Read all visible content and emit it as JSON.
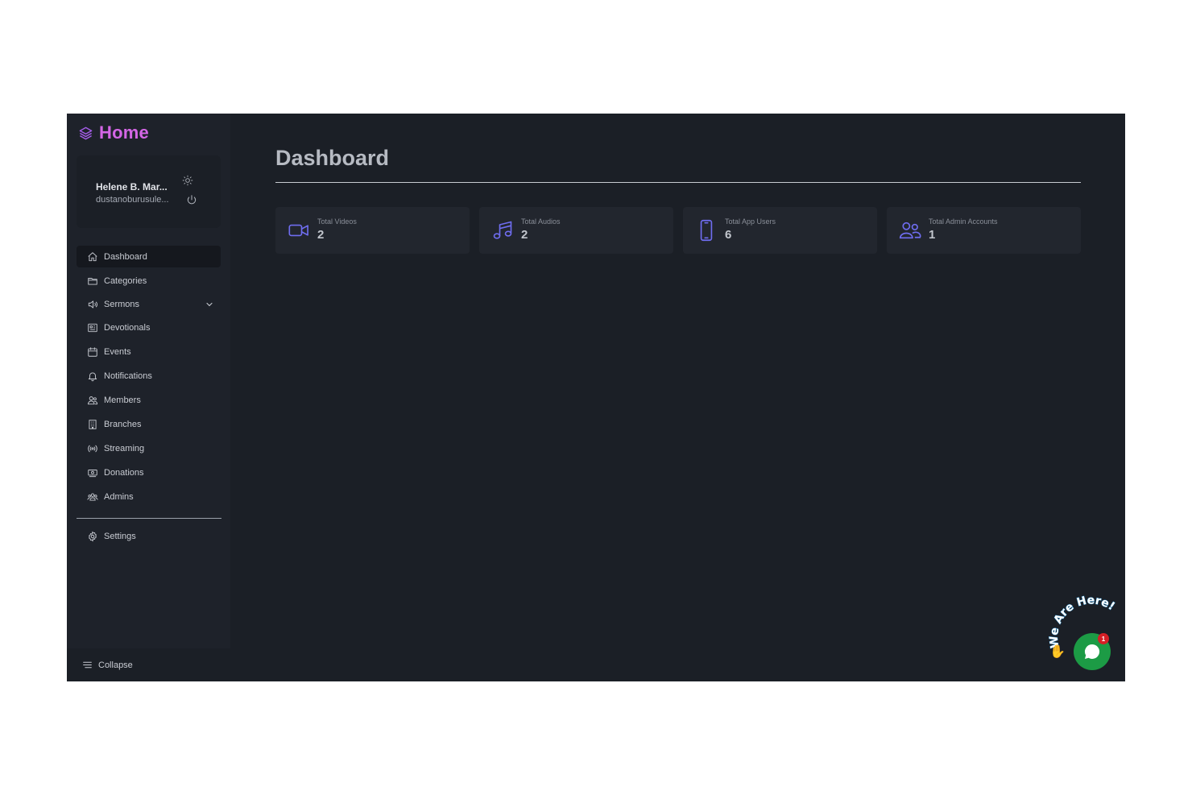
{
  "brand": {
    "title": "Home",
    "icon": "layers-icon",
    "color": "#d466e6"
  },
  "user": {
    "name": "Helene B. Mar...",
    "email": "dustanoburusule..."
  },
  "sidebar": {
    "items": [
      {
        "label": "Dashboard",
        "icon": "home-icon",
        "active": true
      },
      {
        "label": "Categories",
        "icon": "folder-icon"
      },
      {
        "label": "Sermons",
        "icon": "speaker-icon",
        "has_submenu": true
      },
      {
        "label": "Devotionals",
        "icon": "newspaper-icon"
      },
      {
        "label": "Events",
        "icon": "calendar-icon"
      },
      {
        "label": "Notifications",
        "icon": "bell-icon"
      },
      {
        "label": "Members",
        "icon": "users-icon"
      },
      {
        "label": "Branches",
        "icon": "building-icon"
      },
      {
        "label": "Streaming",
        "icon": "broadcast-icon"
      },
      {
        "label": "Donations",
        "icon": "money-icon"
      },
      {
        "label": "Admins",
        "icon": "user-group-icon"
      }
    ],
    "settings": {
      "label": "Settings",
      "icon": "cog-icon"
    },
    "collapse": {
      "label": "Collapse",
      "icon": "menu-lines-icon"
    }
  },
  "main": {
    "title": "Dashboard",
    "stats": [
      {
        "label": "Total Videos",
        "value": "2",
        "icon": "video-camera-icon"
      },
      {
        "label": "Total Audios",
        "value": "2",
        "icon": "music-note-icon"
      },
      {
        "label": "Total App Users",
        "value": "6",
        "icon": "mobile-phone-icon"
      },
      {
        "label": "Total Admin Accounts",
        "value": "1",
        "icon": "users-icon"
      }
    ],
    "accent": "#6f6df0"
  },
  "chat": {
    "tagline": "We Are Here!",
    "badge": "1",
    "button_color": "#1c9b45"
  }
}
